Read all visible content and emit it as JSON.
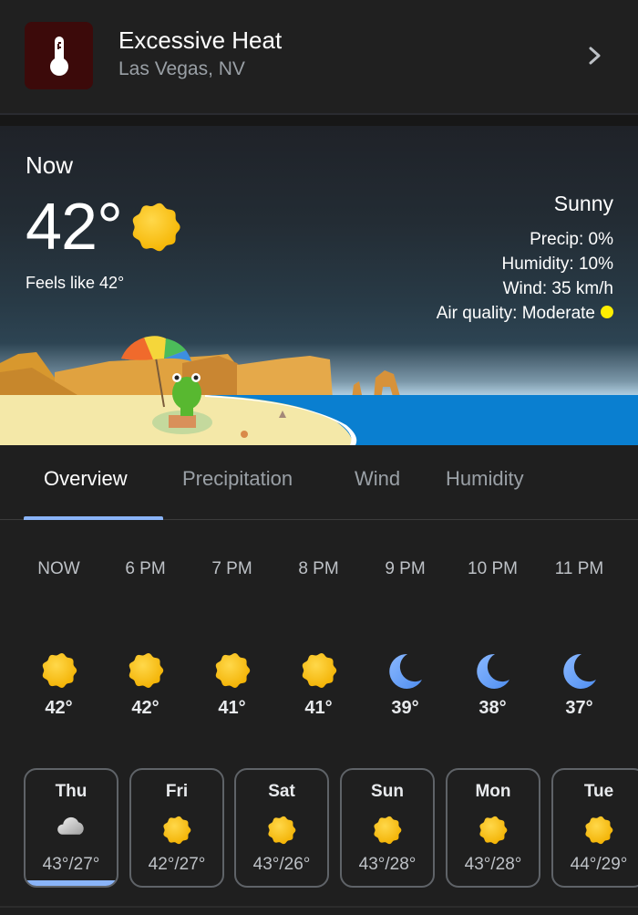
{
  "alert": {
    "icon": "thermometer-icon",
    "title": "Excessive Heat",
    "location": "Las Vegas, NV",
    "icon_bg": "#3c0a0a"
  },
  "current": {
    "label": "Now",
    "temp": "42°",
    "icon": "sun-icon",
    "feels_like": "Feels like 42°",
    "condition": "Sunny",
    "precip": "Precip: 0%",
    "humidity": "Humidity: 10%",
    "wind": "Wind: 35 km/h",
    "air_quality": "Air quality: Moderate",
    "air_quality_color": "#ffee00"
  },
  "tabs": [
    {
      "label": "Overview",
      "active": true
    },
    {
      "label": "Precipitation",
      "active": false
    },
    {
      "label": "Wind",
      "active": false
    },
    {
      "label": "Humidity",
      "active": false
    }
  ],
  "hourly": [
    {
      "time": "NOW",
      "icon": "sun",
      "temp": "42°"
    },
    {
      "time": "6 PM",
      "icon": "sun",
      "temp": "42°"
    },
    {
      "time": "7 PM",
      "icon": "sun",
      "temp": "41°"
    },
    {
      "time": "8 PM",
      "icon": "sun",
      "temp": "41°"
    },
    {
      "time": "9 PM",
      "icon": "moon",
      "temp": "39°"
    },
    {
      "time": "10 PM",
      "icon": "moon",
      "temp": "38°"
    },
    {
      "time": "11 PM",
      "icon": "moon",
      "temp": "37°"
    }
  ],
  "daily": [
    {
      "day": "Thu",
      "icon": "cloud",
      "temps": "43°/27°",
      "selected": true
    },
    {
      "day": "Fri",
      "icon": "sun",
      "temps": "42°/27°",
      "selected": false
    },
    {
      "day": "Sat",
      "icon": "sun",
      "temps": "43°/26°",
      "selected": false
    },
    {
      "day": "Sun",
      "icon": "sun",
      "temps": "43°/28°",
      "selected": false
    },
    {
      "day": "Mon",
      "icon": "sun",
      "temps": "43°/28°",
      "selected": false
    },
    {
      "day": "Tue",
      "icon": "sun",
      "temps": "44°/29°",
      "selected": false
    }
  ],
  "colors": {
    "accent": "#8ab4f8",
    "sun": "#fbc02d",
    "moon": "#6ea2f7"
  }
}
